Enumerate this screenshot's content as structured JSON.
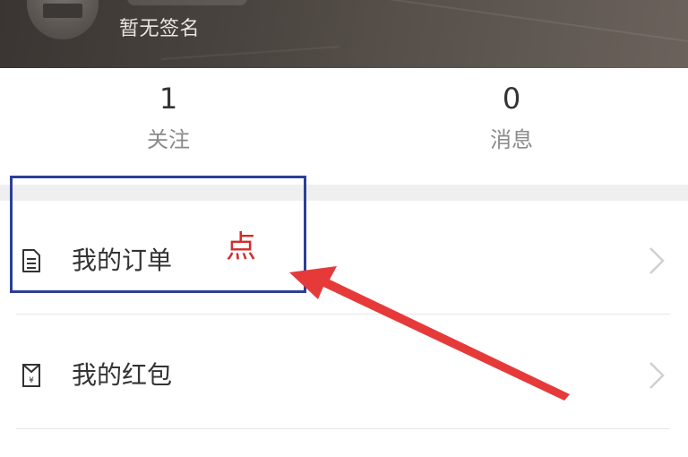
{
  "profile": {
    "signature": "暂无签名"
  },
  "stats": [
    {
      "value": "1",
      "label": "关注"
    },
    {
      "value": "0",
      "label": "消息"
    }
  ],
  "menu": [
    {
      "label": "我的订单",
      "icon": "document-icon"
    },
    {
      "label": "我的红包",
      "icon": "red-packet-icon"
    }
  ],
  "annotation": {
    "text": "点",
    "box_color": "#2c3f96",
    "arrow_color": "#e63a3a"
  },
  "colors": {
    "header_bg": "#4a4440",
    "separator": "#efefef",
    "text_primary": "#333333",
    "text_secondary": "#8a8a8a"
  }
}
